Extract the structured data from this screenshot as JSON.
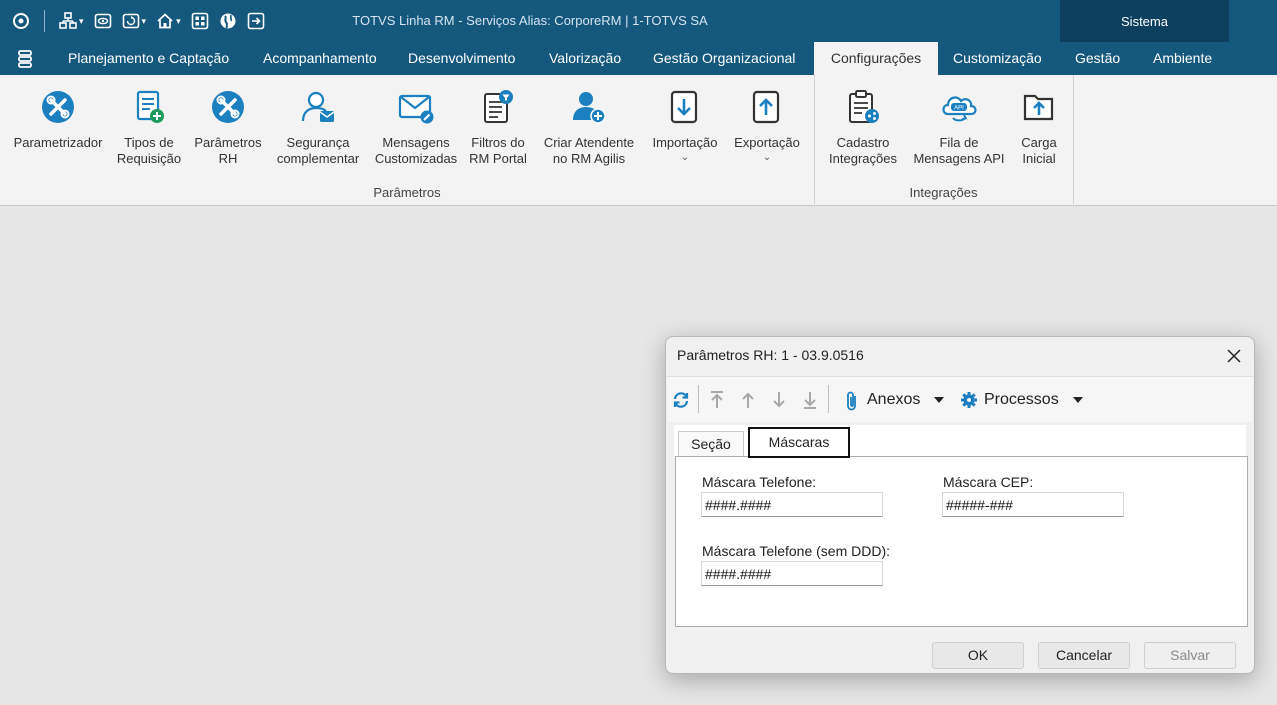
{
  "titlebar": {
    "title": "TOTVS Linha RM - Serviços  Alias: CorporeRM | 1-TOTVS SA",
    "sistema": "Sistema"
  },
  "menu": {
    "tabs": [
      {
        "label": "Planejamento e Captação"
      },
      {
        "label": "Acompanhamento"
      },
      {
        "label": "Desenvolvimento"
      },
      {
        "label": "Valorização"
      },
      {
        "label": "Gestão Organizacional"
      },
      {
        "label": "Configurações"
      },
      {
        "label": "Customização"
      },
      {
        "label": "Gestão"
      },
      {
        "label": "Ambiente"
      }
    ],
    "active_tab": "Configurações"
  },
  "ribbon": {
    "parametros": {
      "label": "Parâmetros",
      "buttons": [
        {
          "line1": "Parametrizador",
          "line2": ""
        },
        {
          "line1": "Tipos de",
          "line2": "Requisição"
        },
        {
          "line1": "Parâmetros",
          "line2": "RH"
        },
        {
          "line1": "Segurança",
          "line2": "complementar"
        },
        {
          "line1": "Mensagens",
          "line2": "Customizadas"
        },
        {
          "line1": "Filtros do",
          "line2": "RM Portal"
        },
        {
          "line1": "Criar Atendente",
          "line2": "no RM Agilis"
        },
        {
          "line1": "Importação",
          "line2": ""
        },
        {
          "line1": "Exportação",
          "line2": ""
        }
      ]
    },
    "integracoes": {
      "label": "Integrações",
      "buttons": [
        {
          "line1": "Cadastro",
          "line2": "Integrações"
        },
        {
          "line1": "Fila de",
          "line2": "Mensagens API"
        },
        {
          "line1": "Carga",
          "line2": "Inicial"
        }
      ]
    }
  },
  "dialog": {
    "title": "Parâmetros RH: 1 - 03.9.0516",
    "toolbar": {
      "anexos": "Anexos",
      "processos": "Processos"
    },
    "tabs": [
      {
        "label": "Seção"
      },
      {
        "label": "Máscaras"
      }
    ],
    "active_tab": "Máscaras",
    "fields": {
      "telefone": {
        "label": "Máscara Telefone:",
        "value": "####.####"
      },
      "cep": {
        "label": "Máscara CEP:",
        "value": "#####-###"
      },
      "telefone_sem_ddd": {
        "label": "Máscara Telefone (sem DDD):",
        "value": "####.####"
      }
    },
    "buttons": {
      "ok": "OK",
      "cancelar": "Cancelar",
      "salvar": "Salvar"
    }
  },
  "colors": {
    "header_blue": "#14587e",
    "sistema_blue": "#0d3f5e",
    "icon_blue": "#1c7fbf",
    "icon_green": "#1f9a5a"
  }
}
